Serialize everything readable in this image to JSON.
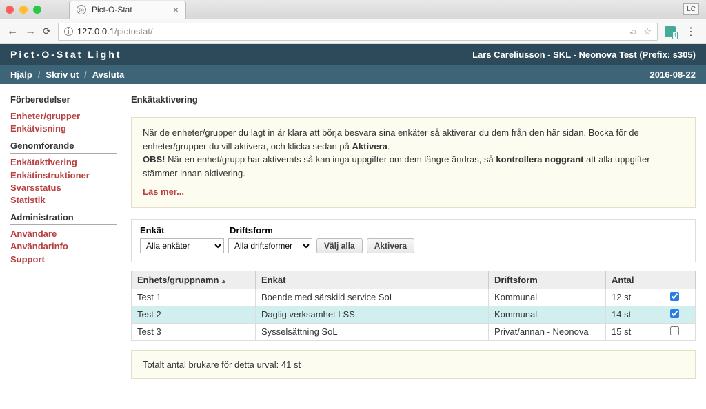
{
  "browser": {
    "tab_title": "Pict-O-Stat",
    "url_host": "127.0.0.1",
    "url_path": "/pictostat/",
    "profile_badge": "LC"
  },
  "header": {
    "app_title": "Pict-O-Stat Light",
    "user_context": "Lars Careliusson - SKL - Neonova Test (Prefix: s305)"
  },
  "menubar": {
    "items": [
      "Hjälp",
      "Skriv ut",
      "Avsluta"
    ],
    "date": "2016-08-22"
  },
  "sidebar": {
    "sections": [
      {
        "title": "Förberedelser",
        "links": [
          "Enheter/grupper",
          "Enkätvisning"
        ]
      },
      {
        "title": "Genomförande",
        "links": [
          "Enkätaktivering",
          "Enkätinstruktioner",
          "Svarsstatus",
          "Statistik"
        ]
      },
      {
        "title": "Administration",
        "links": [
          "Användare",
          "Användarinfo",
          "Support"
        ]
      }
    ]
  },
  "page": {
    "title": "Enkätaktivering",
    "info_line1_a": "När de enheter/grupper du lagt in är klara att börja besvara sina enkäter så aktiverar du dem från den här sidan. Bocka för de enheter/grupper du vill aktivera, och klicka sedan på ",
    "info_line1_b": "Aktivera",
    "info_line1_c": ".",
    "info_line2_a": "OBS!",
    "info_line2_b": " När en enhet/grupp har aktiverats så kan inga uppgifter om dem längre ändras, så ",
    "info_line2_c": "kontrollera noggrant",
    "info_line2_d": " att alla uppgifter stämmer innan aktivering.",
    "read_more": "Läs mer..."
  },
  "filters": {
    "enkat_label": "Enkät",
    "driftsform_label": "Driftsform",
    "enkat_value": "Alla enkäter",
    "driftsform_value": "Alla driftsformer",
    "select_all": "Välj alla",
    "activate": "Aktivera"
  },
  "table": {
    "headers": [
      "Enhets/gruppnamn",
      "Enkät",
      "Driftsform",
      "Antal",
      ""
    ],
    "rows": [
      {
        "name": "Test 1",
        "enkat": "Boende med särskild service SoL",
        "drift": "Kommunal",
        "antal": "12 st",
        "checked": true,
        "selected": false
      },
      {
        "name": "Test 2",
        "enkat": "Daglig verksamhet LSS",
        "drift": "Kommunal",
        "antal": "14 st",
        "checked": true,
        "selected": true
      },
      {
        "name": "Test 3",
        "enkat": "Sysselsättning SoL",
        "drift": "Privat/annan - Neonova",
        "antal": "15 st",
        "checked": false,
        "selected": false
      }
    ]
  },
  "summary": "Totalt antal brukare för detta urval: 41 st"
}
